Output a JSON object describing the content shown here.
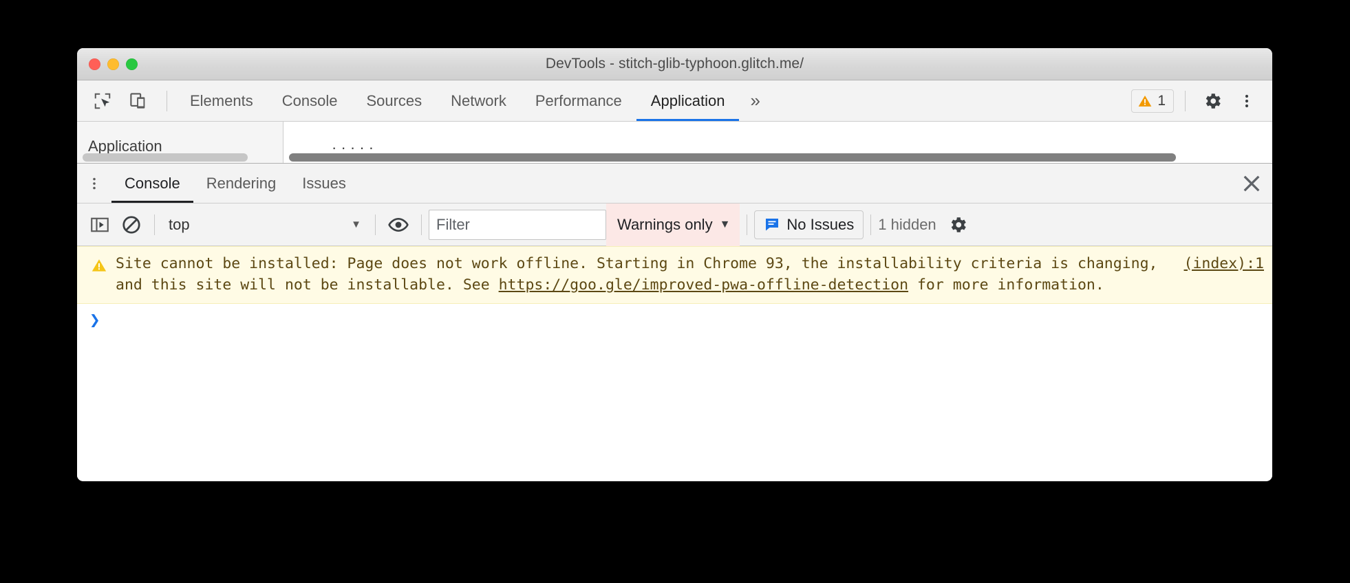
{
  "window": {
    "title": "DevTools - stitch-glib-typhoon.glitch.me/",
    "traffic_lights": {
      "close": "close-button",
      "minimize": "minimize-button",
      "zoom": "zoom-button"
    }
  },
  "main_toolbar": {
    "inspect_icon": "inspect-element-icon",
    "device_toggle_icon": "device-toolbar-icon",
    "tabs": [
      {
        "label": "Elements",
        "active": false
      },
      {
        "label": "Console",
        "active": false
      },
      {
        "label": "Sources",
        "active": false
      },
      {
        "label": "Network",
        "active": false
      },
      {
        "label": "Performance",
        "active": false
      },
      {
        "label": "Application",
        "active": true
      }
    ],
    "more_tabs_label": "»",
    "warning_count": "1",
    "settings_icon": "gear-icon",
    "more_options_icon": "kebab-menu-icon"
  },
  "panel_stub": {
    "sidebar_title": "Application",
    "main_title": "· · · · ·"
  },
  "drawer": {
    "menu_icon": "kebab-menu-icon",
    "tabs": [
      {
        "label": "Console",
        "active": true
      },
      {
        "label": "Rendering",
        "active": false
      },
      {
        "label": "Issues",
        "active": false
      }
    ],
    "close_label": "✕"
  },
  "console_toolbar": {
    "sidebar_toggle_icon": "console-sidebar-icon",
    "clear_icon": "clear-console-icon",
    "context": "top",
    "context_caret": "▼",
    "eye_icon": "live-expression-icon",
    "filter_placeholder": "Filter",
    "filter_value": "",
    "level": "Warnings only",
    "level_caret": "▼",
    "issues_label": "No Issues",
    "issues_icon": "issues-message-icon",
    "hidden_label": "1 hidden",
    "settings_icon": "gear-icon"
  },
  "console_messages": [
    {
      "type": "warning",
      "icon": "warning-triangle-icon",
      "text_before_link": "Site cannot be installed: Page does not work offline. Starting in Chrome 93, the installability criteria is changing, and this site will not be installable. See ",
      "link_text": "https://goo.gle/improved-pwa-offline-detection",
      "text_after_link": " for more information.",
      "source": "(index):1"
    }
  ],
  "console_prompt": {
    "caret": "❯",
    "value": ""
  },
  "colors": {
    "accent_blue": "#1a73e8",
    "warning_yellow": "#f29900",
    "warning_bg": "#fffbe5",
    "error_filter_bg": "#fce8e6",
    "toolbar_bg": "#f3f3f3",
    "issues_blue": "#1a73e8"
  }
}
